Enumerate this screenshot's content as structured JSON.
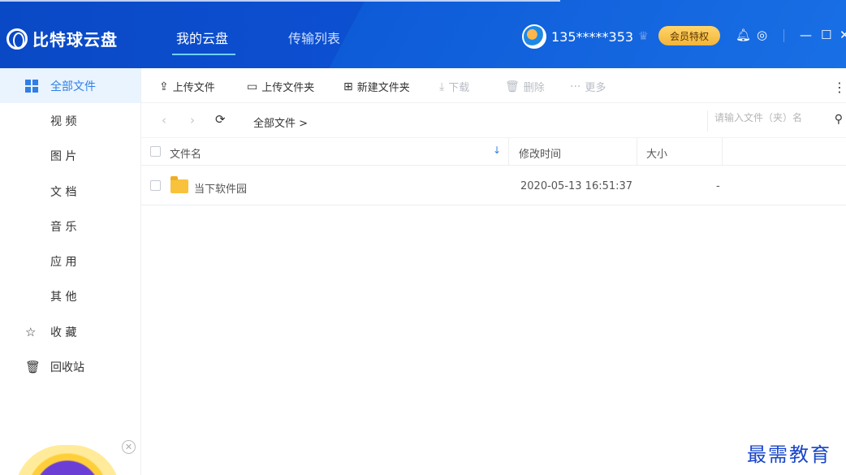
{
  "app": {
    "logo_text": "比特球云盘",
    "tabs": [
      {
        "label": "我的云盘",
        "active": true
      },
      {
        "label": "传输列表",
        "active": false
      }
    ],
    "user": {
      "name": "135*****353"
    },
    "vip_label": "会员特权",
    "colors": {
      "titlebar": "#0c4fd0",
      "accent": "#2f7fe6",
      "vip": "#f3b43a",
      "folder": "#f8c23c"
    }
  },
  "sidebar": {
    "items": [
      {
        "label": "全部文件",
        "icon": "grid-icon",
        "active": true
      },
      {
        "label": "视 频"
      },
      {
        "label": "图 片"
      },
      {
        "label": "文 档"
      },
      {
        "label": "音 乐"
      },
      {
        "label": "应 用"
      },
      {
        "label": "其 他"
      },
      {
        "label": "收 藏",
        "icon": "star-icon"
      },
      {
        "label": "回收站",
        "icon": "trash-icon"
      }
    ]
  },
  "toolbar": {
    "upload_file": "上传文件",
    "upload_folder": "上传文件夹",
    "new_folder": "新建文件夹",
    "download": "下载",
    "delete": "删除",
    "more": "更多"
  },
  "pathbar": {
    "breadcrumb": "全部文件 >",
    "search_placeholder": "请输入文件（夹）名"
  },
  "table": {
    "headers": {
      "name": "文件名",
      "modified": "修改时间",
      "size": "大小"
    },
    "rows": [
      {
        "name": "当下软件园",
        "modified": "2020-05-13 16:51:37",
        "size": "-",
        "type": "folder"
      }
    ]
  },
  "watermark": "最需教育"
}
